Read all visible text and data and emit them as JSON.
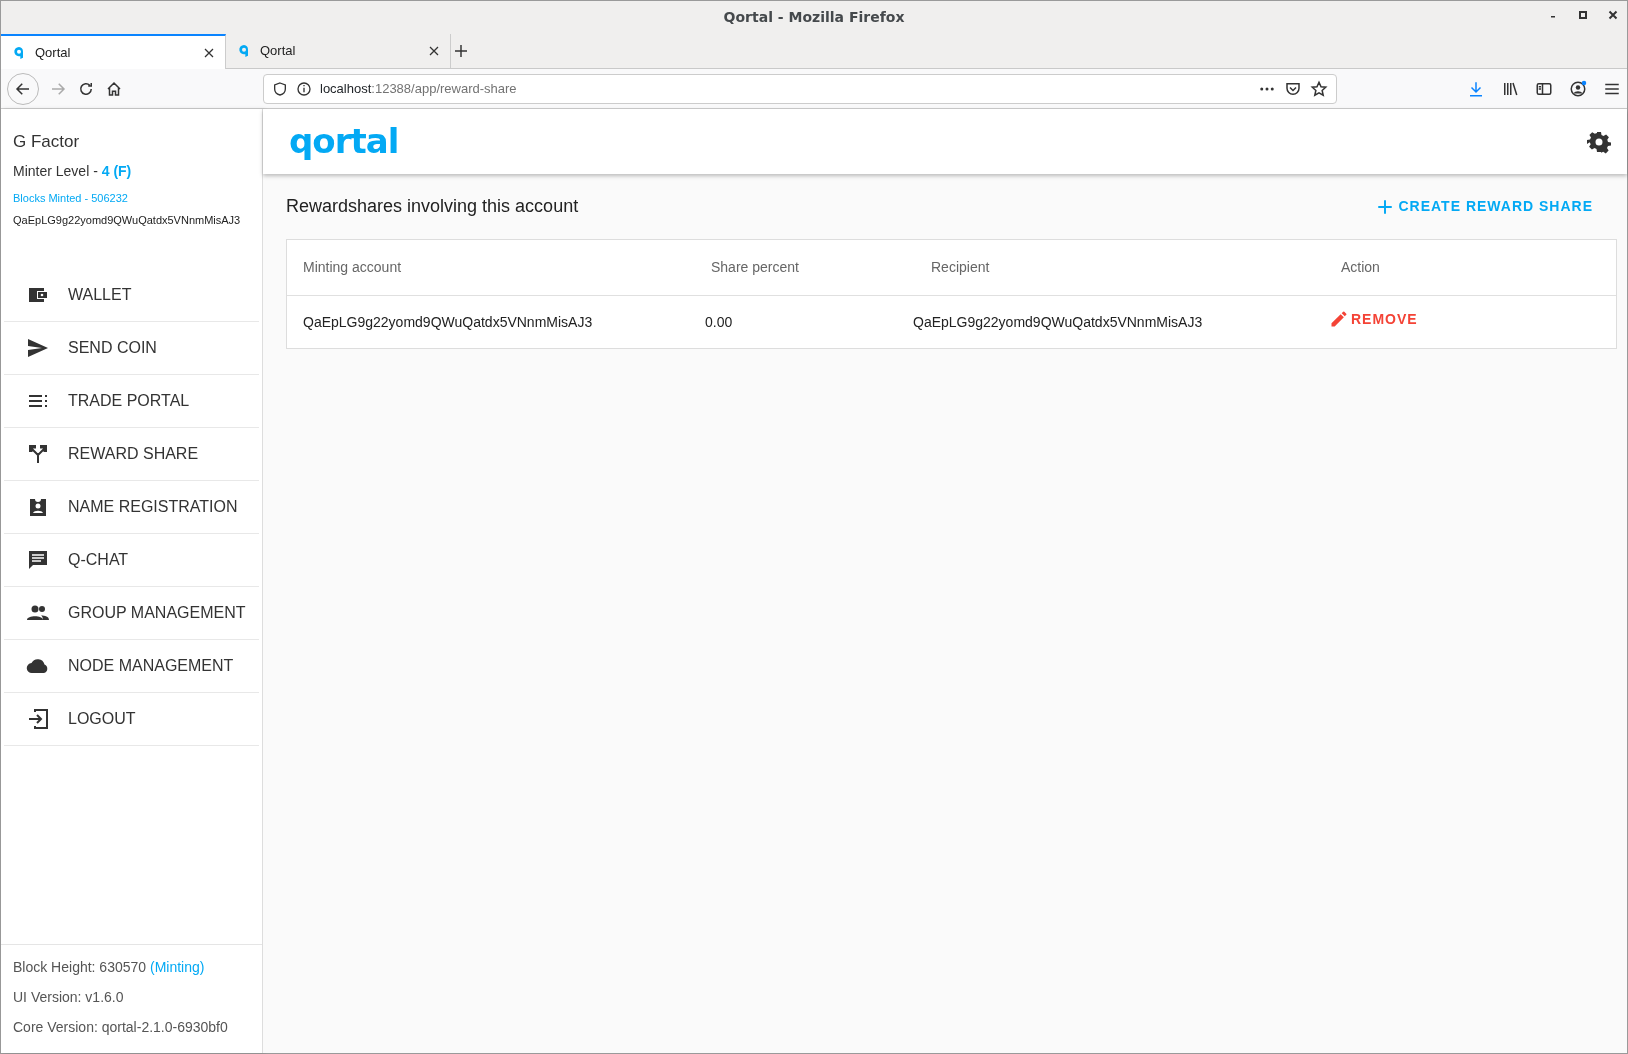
{
  "window": {
    "title": "Qortal - Mozilla Firefox"
  },
  "tabs": [
    {
      "label": "Qortal",
      "selected": true
    },
    {
      "label": "Qortal",
      "selected": false
    }
  ],
  "address_bar": {
    "host": "localhost",
    "path": ":12388/app/reward-share"
  },
  "sidebar": {
    "user_name": "G Factor",
    "minter_level": {
      "label": "Minter Level -",
      "value": "4 (F)"
    },
    "blocks_minted": "Blocks Minted - 506232",
    "address": "QaEpLG9g22yomd9QWuQatdx5VNnmMisAJ3",
    "items": [
      {
        "label": "WALLET"
      },
      {
        "label": "SEND COIN"
      },
      {
        "label": "TRADE PORTAL"
      },
      {
        "label": "REWARD SHARE"
      },
      {
        "label": "NAME REGISTRATION"
      },
      {
        "label": "Q-CHAT"
      },
      {
        "label": "GROUP MANAGEMENT"
      },
      {
        "label": "NODE MANAGEMENT"
      },
      {
        "label": "LOGOUT"
      }
    ],
    "footer": {
      "block_height": "Block Height: 630570",
      "minting_status": "(Minting)",
      "ui_version": "UI Version: v1.6.0",
      "core_version": "Core Version: qortal-2.1.0-6930bf0"
    }
  },
  "header": {
    "logo": "qortal"
  },
  "page": {
    "title": "Rewardshares involving this account",
    "create_button": "CREATE REWARD SHARE",
    "table": {
      "columns": [
        "Minting account",
        "Share percent",
        "Recipient",
        "Action"
      ],
      "rows": [
        {
          "minting_account": "QaEpLG9g22yomd9QWuQatdx5VNnmMisAJ3",
          "share_percent": "0.00",
          "recipient": "QaEpLG9g22yomd9QWuQatdx5VNnmMisAJ3",
          "action": "REMOVE"
        }
      ]
    }
  }
}
